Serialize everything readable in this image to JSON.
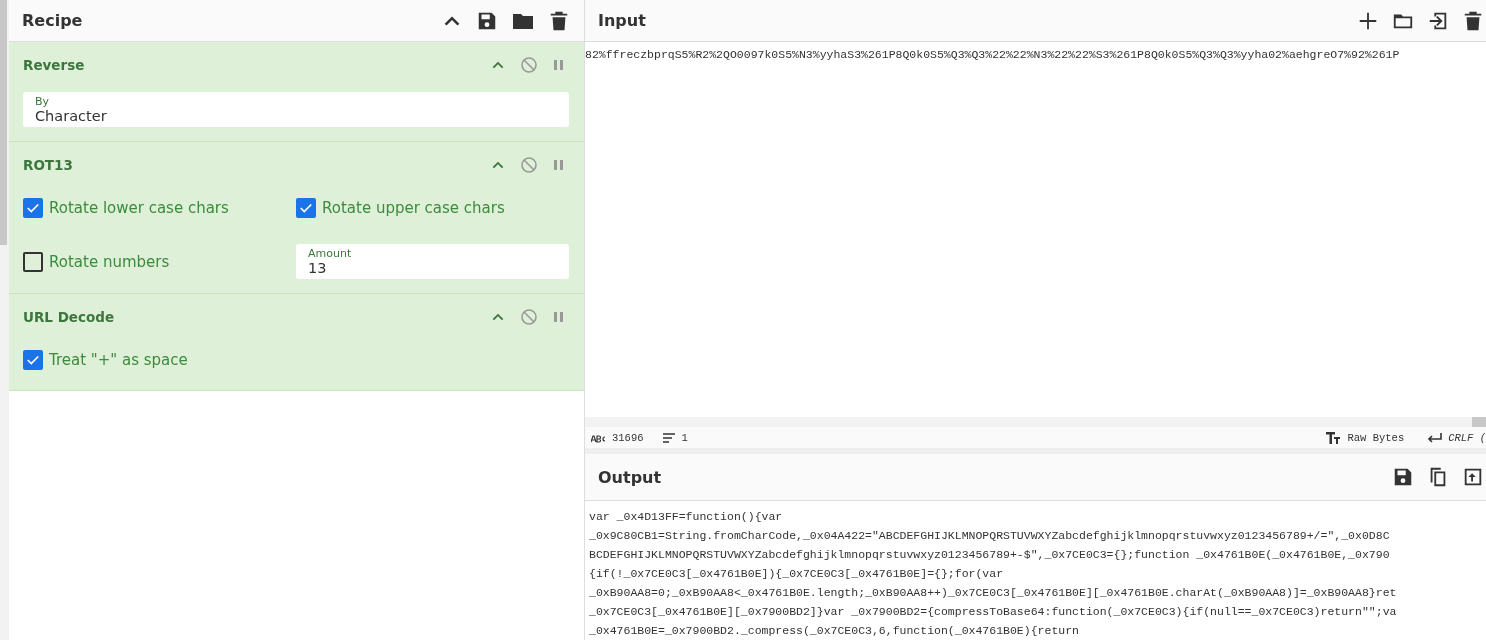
{
  "recipe": {
    "title": "Recipe",
    "operations": [
      {
        "name": "Reverse",
        "args": [
          {
            "kind": "field",
            "label": "By",
            "value": "Character"
          }
        ]
      },
      {
        "name": "ROT13",
        "args": [
          {
            "kind": "checkbox",
            "label": "Rotate lower case chars",
            "checked": true
          },
          {
            "kind": "checkbox",
            "label": "Rotate upper case chars",
            "checked": true
          },
          {
            "kind": "checkbox",
            "label": "Rotate numbers",
            "checked": false
          },
          {
            "kind": "field",
            "label": "Amount",
            "value": "13"
          }
        ]
      },
      {
        "name": "URL Decode",
        "args": [
          {
            "kind": "checkbox",
            "label": "Treat \"+\" as space",
            "checked": true
          }
        ]
      }
    ]
  },
  "input": {
    "title": "Input",
    "text": "82%ffreczbprqS5%R2%2QO0097k0S5%N3%yyhaS3%261P8Q0k0S5%Q3%Q3%22%22%N3%22%22%S3%261P8Q0k0S5%Q3%Q3%yyha02%aehgreO7%92%261P",
    "status": {
      "length": "31696",
      "lines": "1",
      "format": "Raw Bytes",
      "eol": "CRLF ("
    }
  },
  "output": {
    "title": "Output",
    "lines": [
      "var _0x4D13FF=function(){var",
      "_0x9C80CB1=String.fromCharCode,_0x04A422=\"ABCDEFGHIJKLMNOPQRSTUVWXYZabcdefghijklmnopqrstuvwxyz0123456789+/=\",_0x0D8C",
      "BCDEFGHIJKLMNOPQRSTUVWXYZabcdefghijklmnopqrstuvwxyz0123456789+-$\",_0x7CE0C3={};function _0x4761B0E(_0x4761B0E,_0x790",
      "{if(!_0x7CE0C3[_0x4761B0E]){_0x7CE0C3[_0x4761B0E]={};for(var",
      "_0xB90AA8=0;_0xB90AA8<_0x4761B0E.length;_0xB90AA8++)_0x7CE0C3[_0x4761B0E][_0x4761B0E.charAt(_0xB90AA8)]=_0xB90AA8}ret",
      "_0x7CE0C3[_0x4761B0E][_0x7900BD2]}var _0x7900BD2={compressToBase64:function(_0x7CE0C3){if(null==_0x7CE0C3)return\"\";va",
      "_0x4761B0E=_0x7900BD2._compress(_0x7CE0C3,6,function(_0x4761B0E){return"
    ]
  }
}
